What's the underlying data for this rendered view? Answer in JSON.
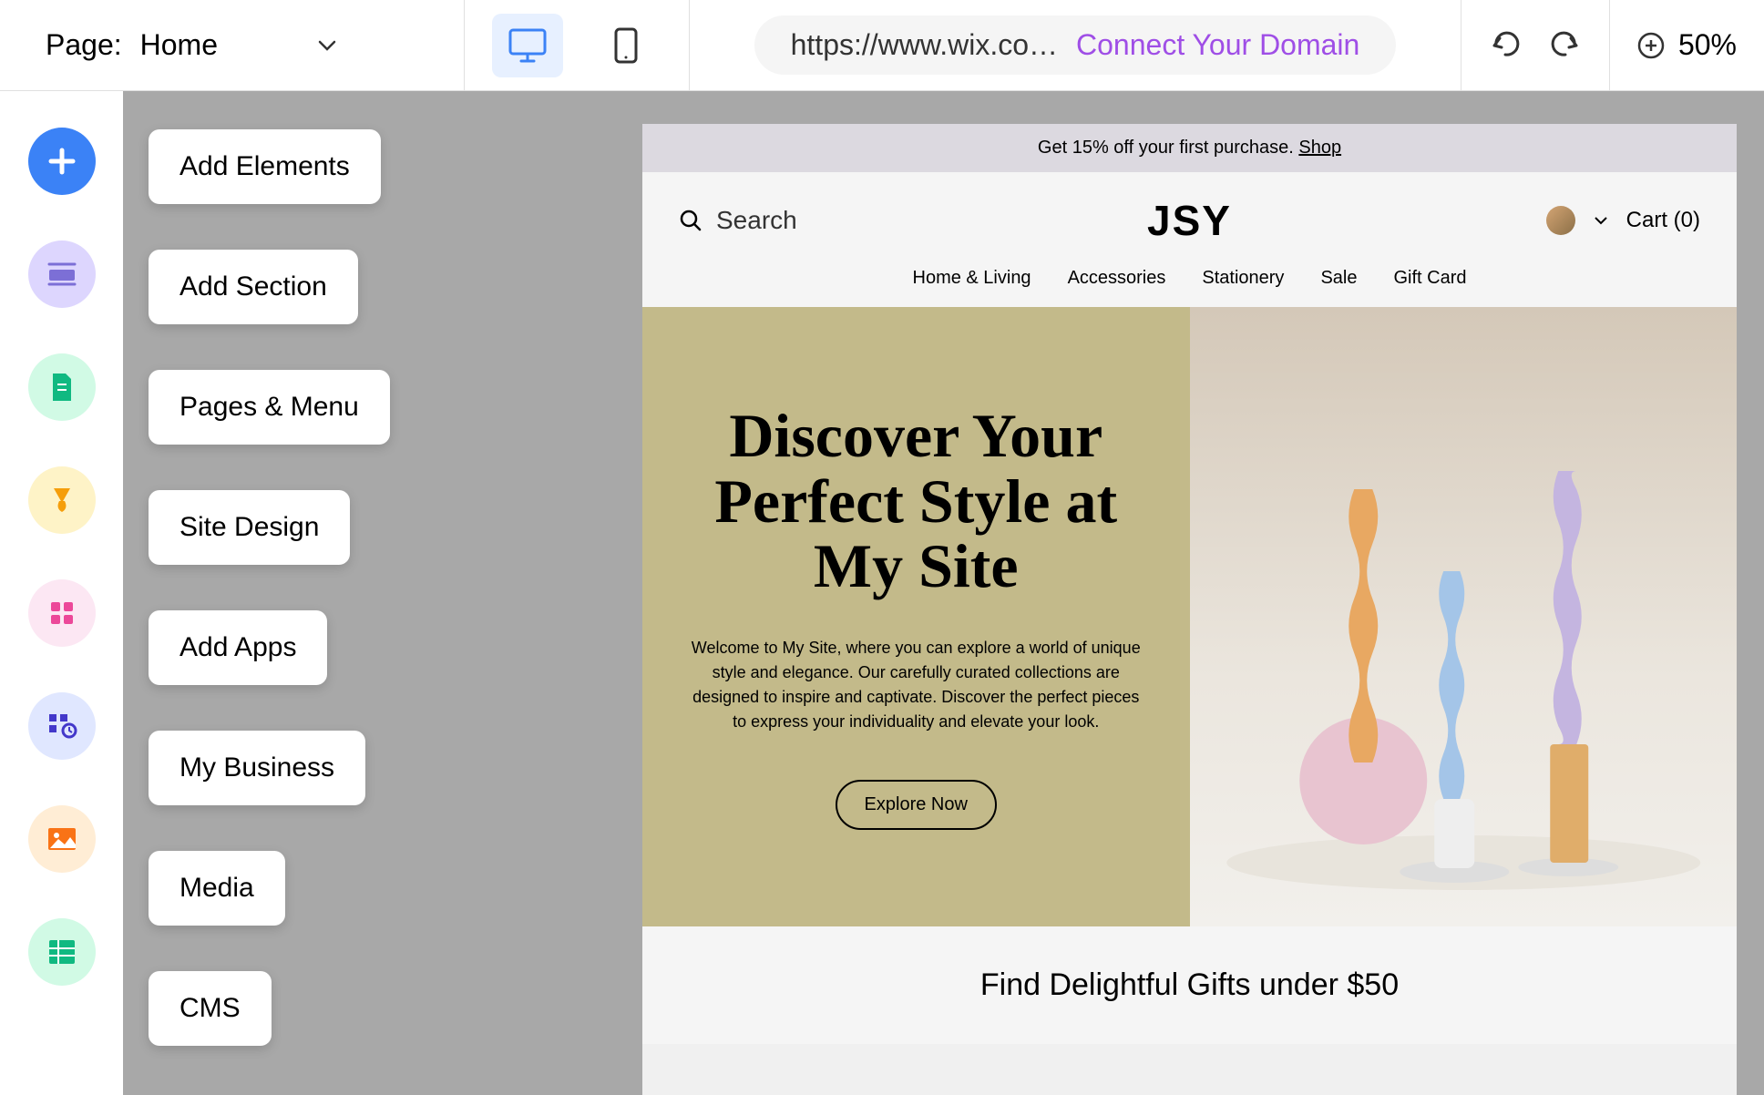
{
  "topbar": {
    "page_label": "Page:",
    "page_name": "Home",
    "url": "https://www.wix.co…",
    "connect_link": "Connect Your Domain",
    "zoom": "50%"
  },
  "sidebar": {
    "labels": [
      "Add Elements",
      "Add Section",
      "Pages & Menu",
      "Site Design",
      "Add Apps",
      "My Business",
      "Media",
      "CMS"
    ],
    "icon_colors": {
      "add_elements": "#3b82f6",
      "add_section": "#c4b5fd",
      "pages_menu": "#bbf7d0",
      "site_design": "#fde68a",
      "add_apps": "#fce7f3",
      "my_business": "#e0e7ff",
      "media": "#fed7aa",
      "cms": "#bbf7d0"
    }
  },
  "preview": {
    "banner_text": "Get 15% off your first purchase. ",
    "banner_link": "Shop",
    "search_label": "Search",
    "logo": "JSY",
    "cart_label": "Cart (0)",
    "nav": [
      "Home & Living",
      "Accessories",
      "Stationery",
      "Sale",
      "Gift Card"
    ],
    "hero_title": "Discover Your Perfect Style at My Site",
    "hero_desc": "Welcome to My Site, where you can explore a world of unique style and elegance. Our carefully curated collections are designed to inspire and captivate. Discover the perfect pieces to express your individuality and elevate your look.",
    "hero_button": "Explore Now",
    "gifts_heading": "Find Delightful Gifts under $50"
  }
}
